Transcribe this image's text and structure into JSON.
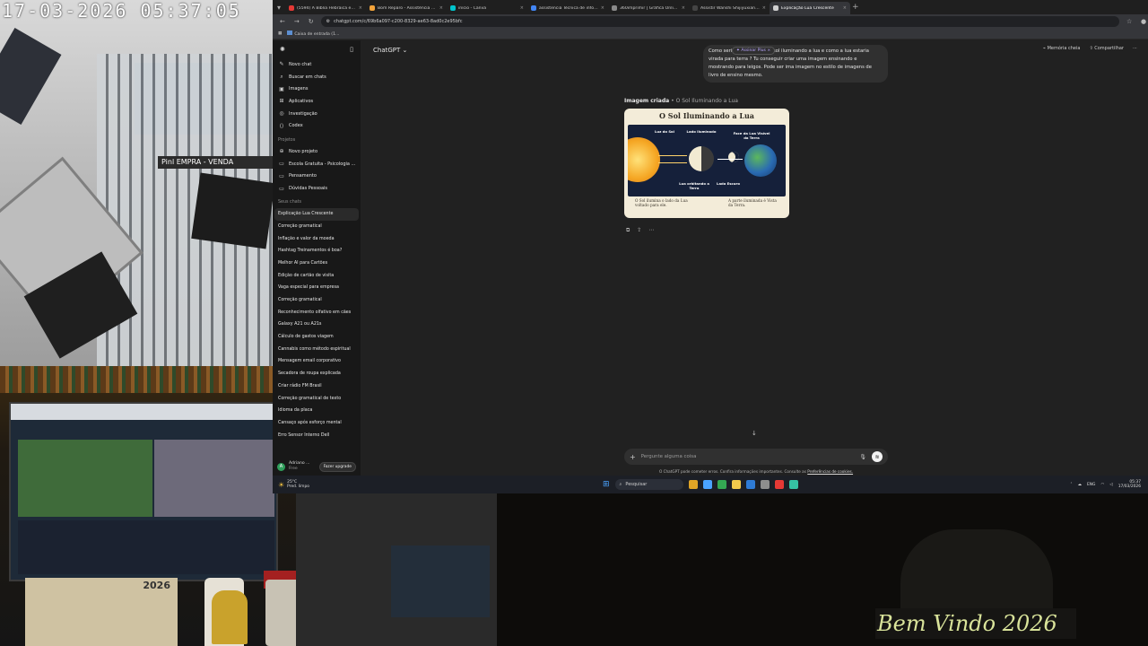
{
  "overlay": {
    "timestamp": "17-03-2026  05:37:05",
    "shop_sign": "Pinl       EMPRA - VENDA",
    "calendar_year": "2026",
    "welcome": "Bem Vindo 2026"
  },
  "browser": {
    "tabs": [
      {
        "label": "(5594) A Bíblia Hebraica em 4",
        "color": "#e53935"
      },
      {
        "label": "Bom Reparo - Assistência Técn",
        "color": "#f2a33a"
      },
      {
        "label": "início - Canva",
        "color": "#00c4cc"
      },
      {
        "label": "assistencia Técnica de informat",
        "color": "#4285f4"
      },
      {
        "label": "360imprimir | Gráfica Online, I",
        "color": "#8a8a8a"
      },
      {
        "label": "Assistir Wanshi Shijiyuxian Epi",
        "color": "#444444"
      },
      {
        "label": "Explicação Lua Crescente",
        "color": "#cfcfcf"
      }
    ],
    "url": "chatgpt.com/c/69b6a097-c200-8329-ae63-8ad0c2e95bfc",
    "bookmark": "Caixa de entrada (1..."
  },
  "sidebar": {
    "nav": [
      {
        "label": "Novo chat",
        "icon": "edit-icon"
      },
      {
        "label": "Buscar em chats",
        "icon": "search-icon"
      },
      {
        "label": "Imagens",
        "icon": "image-icon"
      },
      {
        "label": "Aplicativos",
        "icon": "apps-icon"
      },
      {
        "label": "Investigação",
        "icon": "research-icon"
      },
      {
        "label": "Codex",
        "icon": "code-icon"
      }
    ],
    "projects_heading": "Projetos",
    "projects": [
      {
        "label": "Novo projeto",
        "icon": "folder-plus-icon"
      },
      {
        "label": "Escola Gratuita - Psicologia ...",
        "icon": "folder-icon"
      },
      {
        "label": "Pensamento",
        "icon": "folder-icon"
      },
      {
        "label": "Dúvidas Pessoais",
        "icon": "folder-icon"
      }
    ],
    "chats_heading": "Seus chats",
    "chats": [
      "Explicação Lua Crescente",
      "Correção gramatical",
      "Inflação e valor da moeda",
      "Hashtag Treinamentos é boa?",
      "Melhor AI para Cartões",
      "Edição de cartão de visita",
      "Vaga especial para empresa",
      "Correção gramatical",
      "Reconhecimento olfativo em cães",
      "Galaxy A21 ou A21s",
      "Cálculo de gastos viagem",
      "Cannabis como método espiritual",
      "Mensagem email corporativo",
      "Secadora de roupa explicada",
      "Criar rádio FM Brasil",
      "Correção gramatical de texto",
      "Idioma da placa",
      "Cansaço após esforço mental",
      "Erro Sensor Interno Dell"
    ],
    "user": {
      "initial": "A",
      "name": "Adriano ...",
      "plan": "Free",
      "upgrade": "Fazer upgrade"
    }
  },
  "main": {
    "model": "ChatGPT",
    "memory": "Memória cheia",
    "share": "Compartilhar",
    "plus_pill": "Assinar Plus",
    "user_message": "Como seri desse retrato do sol iluminando a lua e como a lua estaria virada para terra ? Tu conseguir criar uma imagem ensinando e mostrando para leigos. Pode ser ima imagem no estilo de imagens de livro de ensino mesmo.",
    "image_label": "Imagem criada",
    "image_sub": "• O Sol Iluminando a Lua",
    "image": {
      "title": "O Sol Iluminando a Lua",
      "sun": "Luz do Sol",
      "lit": "Lado Iluminado",
      "face": "Face da Lua Visível da Terra",
      "dark": "Lado Escuro",
      "orbit": "Lua orbitando a Terra",
      "caption_left": "O Sol ilumina o lado da Lua voltado para ele.",
      "caption_right": "A parte iluminada é Vista da Terra."
    },
    "composer_placeholder": "Pergunte alguma coisa",
    "disclaimer": "O ChatGPT pode cometer erros. Confira informações importantes. Consulte as",
    "disclaimer_link": "Preferências de cookies."
  },
  "taskbar": {
    "temp": "25°C",
    "weather": "Pred. limpo",
    "search": "Pesquisar",
    "lang": "ENG",
    "time": "05:37",
    "date": "17/03/2026",
    "apps": [
      "#e0a526",
      "#4aa3ff",
      "#34a853",
      "#f2c94c",
      "#2e7bd6",
      "#8e8e8e",
      "#e53935",
      "#36c2a4"
    ]
  }
}
